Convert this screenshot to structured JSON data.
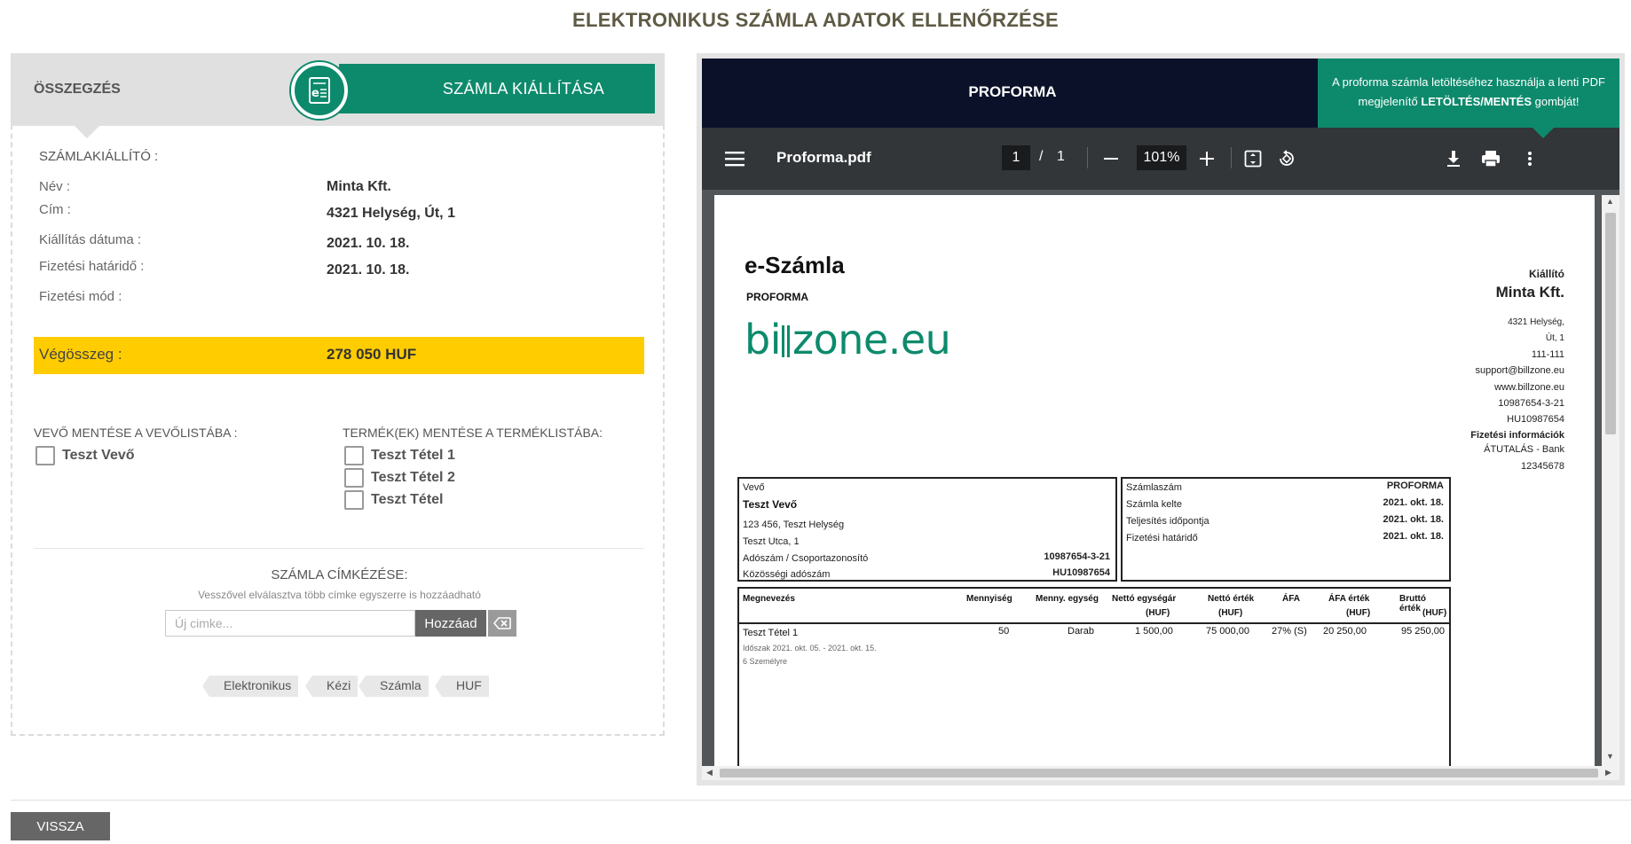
{
  "page": {
    "title": "ELEKTRONIKUS SZÁMLA ADATOK ELLENŐRZÉSE"
  },
  "summary": {
    "title": "ÖSSZEGZÉS",
    "issue_button": "SZÁMLA KIÁLLÍTÁSA",
    "issuer_caption": "SZÁMLAKIÁLLÍTÓ :",
    "rows": [
      {
        "label": "Név :",
        "value": "Minta Kft."
      },
      {
        "label": "Cím :",
        "value": "4321 Helység, Út, 1"
      },
      {
        "label": "Kiállítás dátuma :",
        "value": "2021. 10. 18."
      },
      {
        "label": "Fizetési határidő :",
        "value": "2021. 10. 18."
      },
      {
        "label": "Fizetési mód :",
        "value": ""
      }
    ],
    "total_label": "Végösszeg :",
    "total_value": "278 050 HUF",
    "buyer_save_caption": "VEVŐ MENTÉSE A VEVŐLISTÁBA :",
    "buyer_items": [
      "Teszt Vevő"
    ],
    "product_save_caption": "TERMÉK(EK) MENTÉSE A TERMÉKLISTÁBA:",
    "product_items": [
      "Teszt Tétel 1",
      "Teszt Tétel 2",
      "Teszt Tétel"
    ],
    "tag_title": "SZÁMLA CÍMKÉZÉSE:",
    "tag_hint": "Vesszővel elválasztva több címke egyszerre is hozzáadható",
    "tag_placeholder": "Új cimke...",
    "tag_add_label": "Hozzáad",
    "tags": [
      "Elektronikus",
      "Kézi",
      "Számla",
      "HUF"
    ]
  },
  "preview": {
    "header_title": "PROFORMA",
    "hint_prefix": "A proforma számla letöltéséhez használja a lenti PDF megjelenítő ",
    "hint_bold": "LETÖLTÉS/MENTÉS",
    "hint_suffix": " gombját!",
    "pdf_toolbar": {
      "filename": "Proforma.pdf",
      "page_current": "1",
      "page_separator": "/",
      "page_total": "1",
      "zoom": "101%"
    },
    "invoice": {
      "title": "e-Számla",
      "subtitle": "PROFORMA",
      "logo_text_left": "bi",
      "logo_text_right": "zone.eu",
      "issuer_caption": "Kiállító",
      "issuer_name": "Minta Kft.",
      "issuer_lines": [
        "4321 Helység,",
        "Út, 1",
        "111-111",
        "support@billzone.eu",
        "www.billzone.eu",
        "10987654-3-21",
        "HU10987654"
      ],
      "payment_caption": "Fizetési információk",
      "payment_lines": [
        "ÁTUTALÁS - Bank",
        "12345678"
      ],
      "buyer_box": {
        "caption": "Vevő",
        "name": "Teszt Vevő",
        "address1": "123 456, Teszt Helység",
        "address2": "Teszt Utca, 1",
        "tax_label": "Adószám / Csoportazonosító",
        "tax_value": "10987654-3-21",
        "eu_tax_label": "Közösségi adószám",
        "eu_tax_value": "HU10987654"
      },
      "info_box": [
        {
          "label": "Számlaszám",
          "value": "PROFORMA"
        },
        {
          "label": "Számla kelte",
          "value": "2021. okt. 18."
        },
        {
          "label": "Teljesítés időpontja",
          "value": "2021. okt. 18."
        },
        {
          "label": "Fizetési határidő",
          "value": "2021. okt. 18."
        }
      ],
      "table_headers": [
        "Megnevezés",
        "Mennyiség",
        "Menny. egység",
        "Nettó egységár",
        "Nettó érték",
        "ÁFA",
        "ÁFA érték",
        "Bruttó érték"
      ],
      "table_subheaders": [
        "(HUF)",
        "(HUF)",
        "(HUF)",
        "(HUF)"
      ],
      "row": {
        "name": "Teszt Tétel 1",
        "qty": "50",
        "unit": "Darab",
        "unit_price": "1 500,00",
        "net": "75 000,00",
        "vat": "27% (S)",
        "vat_amount": "20 250,00",
        "gross": "95 250,00",
        "period": "Időszak 2021. okt. 05. - 2021. okt. 15.",
        "note": "6 Személyre"
      }
    }
  },
  "footer": {
    "back_label": "VISSZA"
  }
}
